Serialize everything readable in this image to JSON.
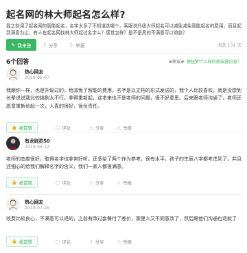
{
  "question": {
    "title": "起名网的林大师起名怎么样?",
    "description": "我之前用了起名网的智能起名，名字太多了不知道选哪个。客服说升级大师起名可以减免减免智能起名的费用，而且起到满意为止，有人在起名网找林大师起过名字么？感觉怎样？是不是真的不满意可以退款？",
    "answer_button": "我来答",
    "share": "分享",
    "report": "举报",
    "views": "浏览 131 次"
  },
  "answers_header": {
    "count": "6个回答",
    "hot_tag": "#热议#",
    "recommend_link": "哪些梦什么样的朋友圈内容？"
  },
  "answers": [
    {
      "username": "热心网友",
      "date": "2019-06-07",
      "avatar_type": "sketch-icon",
      "text": "我跟你一样，也是升级过的，给减免了智能的费用。名字是以文档的形式发送的，我个人比较喜欢，就是没想到长辈说说我比较挑剔太不行，非得重新起，这本来也不是老师的问题，很不好意思。后来跟老师沟通了，老师还愿意重新给起一次，人真的很好，很负责任。",
      "like": "抢首赞",
      "comment": "评论",
      "share": "分享",
      "report": "举报"
    },
    {
      "username": "有龙则灵50",
      "date": "2019-06-12",
      "avatar_type": "dark-figure-icon",
      "text": "老师的态度很好，取得名字也非常好听。还多给了两个作为参考，很有水平。孩子的生辰八字都考虑到了，并且还细心的给我们解释名字的含义，我们一家人都很满意。",
      "like": "抢首赞",
      "comment": "评论",
      "share": "分享",
      "report": "举报"
    },
    {
      "username": "热心网友",
      "date": "2019-07-25",
      "avatar_type": "sketch-icon",
      "text": "收费比较良心，不满意可以退的，之前有改过套餐付了差价，家里人又不同意改了，然后跟他们沟通也退款了",
      "like": "抢首赞",
      "comment": "评论",
      "share": "分享",
      "report": "举报"
    }
  ],
  "colors": {
    "accent": "#38b764",
    "text_primary": "#222222",
    "text_muted": "#999999"
  }
}
